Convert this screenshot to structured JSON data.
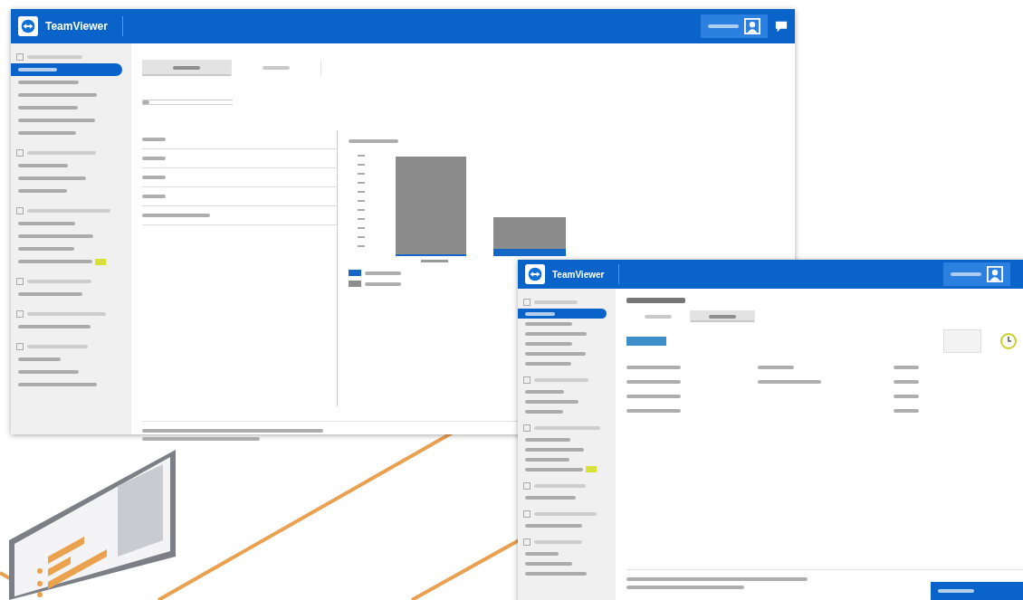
{
  "windows": [
    {
      "kind": "chart",
      "brand": "TeamViewer",
      "tabs": [
        {
          "selected": true
        },
        {
          "selected": false
        }
      ],
      "sidebar": [
        {
          "items": [
            {
              "selected": true,
              "badge": false
            },
            {
              "selected": false,
              "badge": false
            },
            {
              "selected": false,
              "badge": false
            },
            {
              "selected": false,
              "badge": false
            },
            {
              "selected": false,
              "badge": false
            },
            {
              "selected": false,
              "badge": false
            }
          ]
        },
        {
          "items": [
            {
              "selected": false,
              "badge": false
            },
            {
              "selected": false,
              "badge": false
            },
            {
              "selected": false,
              "badge": false
            }
          ]
        },
        {
          "items": [
            {
              "selected": false,
              "badge": false
            },
            {
              "selected": false,
              "badge": false
            },
            {
              "selected": false,
              "badge": false
            },
            {
              "selected": false,
              "badge": true
            }
          ]
        },
        {
          "items": [
            {
              "selected": false,
              "badge": false
            }
          ]
        },
        {
          "items": [
            {
              "selected": false,
              "badge": false
            }
          ]
        },
        {
          "items": [
            {
              "selected": false,
              "badge": false
            },
            {
              "selected": false,
              "badge": false
            },
            {
              "selected": false,
              "badge": false
            }
          ]
        }
      ]
    },
    {
      "kind": "table",
      "brand": "TeamViewer",
      "tabs": [
        {
          "selected": false
        },
        {
          "selected": true
        }
      ],
      "sidebar": [
        {
          "items": [
            {
              "selected": true,
              "badge": false
            },
            {
              "selected": false,
              "badge": false
            },
            {
              "selected": false,
              "badge": false
            },
            {
              "selected": false,
              "badge": false
            },
            {
              "selected": false,
              "badge": false
            },
            {
              "selected": false,
              "badge": false
            }
          ]
        },
        {
          "items": [
            {
              "selected": false,
              "badge": false
            },
            {
              "selected": false,
              "badge": false
            },
            {
              "selected": false,
              "badge": false
            }
          ]
        },
        {
          "items": [
            {
              "selected": false,
              "badge": false
            },
            {
              "selected": false,
              "badge": false
            },
            {
              "selected": false,
              "badge": false
            },
            {
              "selected": false,
              "badge": true
            }
          ]
        },
        {
          "items": [
            {
              "selected": false,
              "badge": false
            }
          ]
        },
        {
          "items": [
            {
              "selected": false,
              "badge": false
            }
          ]
        },
        {
          "items": [
            {
              "selected": false,
              "badge": false
            },
            {
              "selected": false,
              "badge": false
            },
            {
              "selected": false,
              "badge": false
            }
          ]
        }
      ]
    }
  ]
}
